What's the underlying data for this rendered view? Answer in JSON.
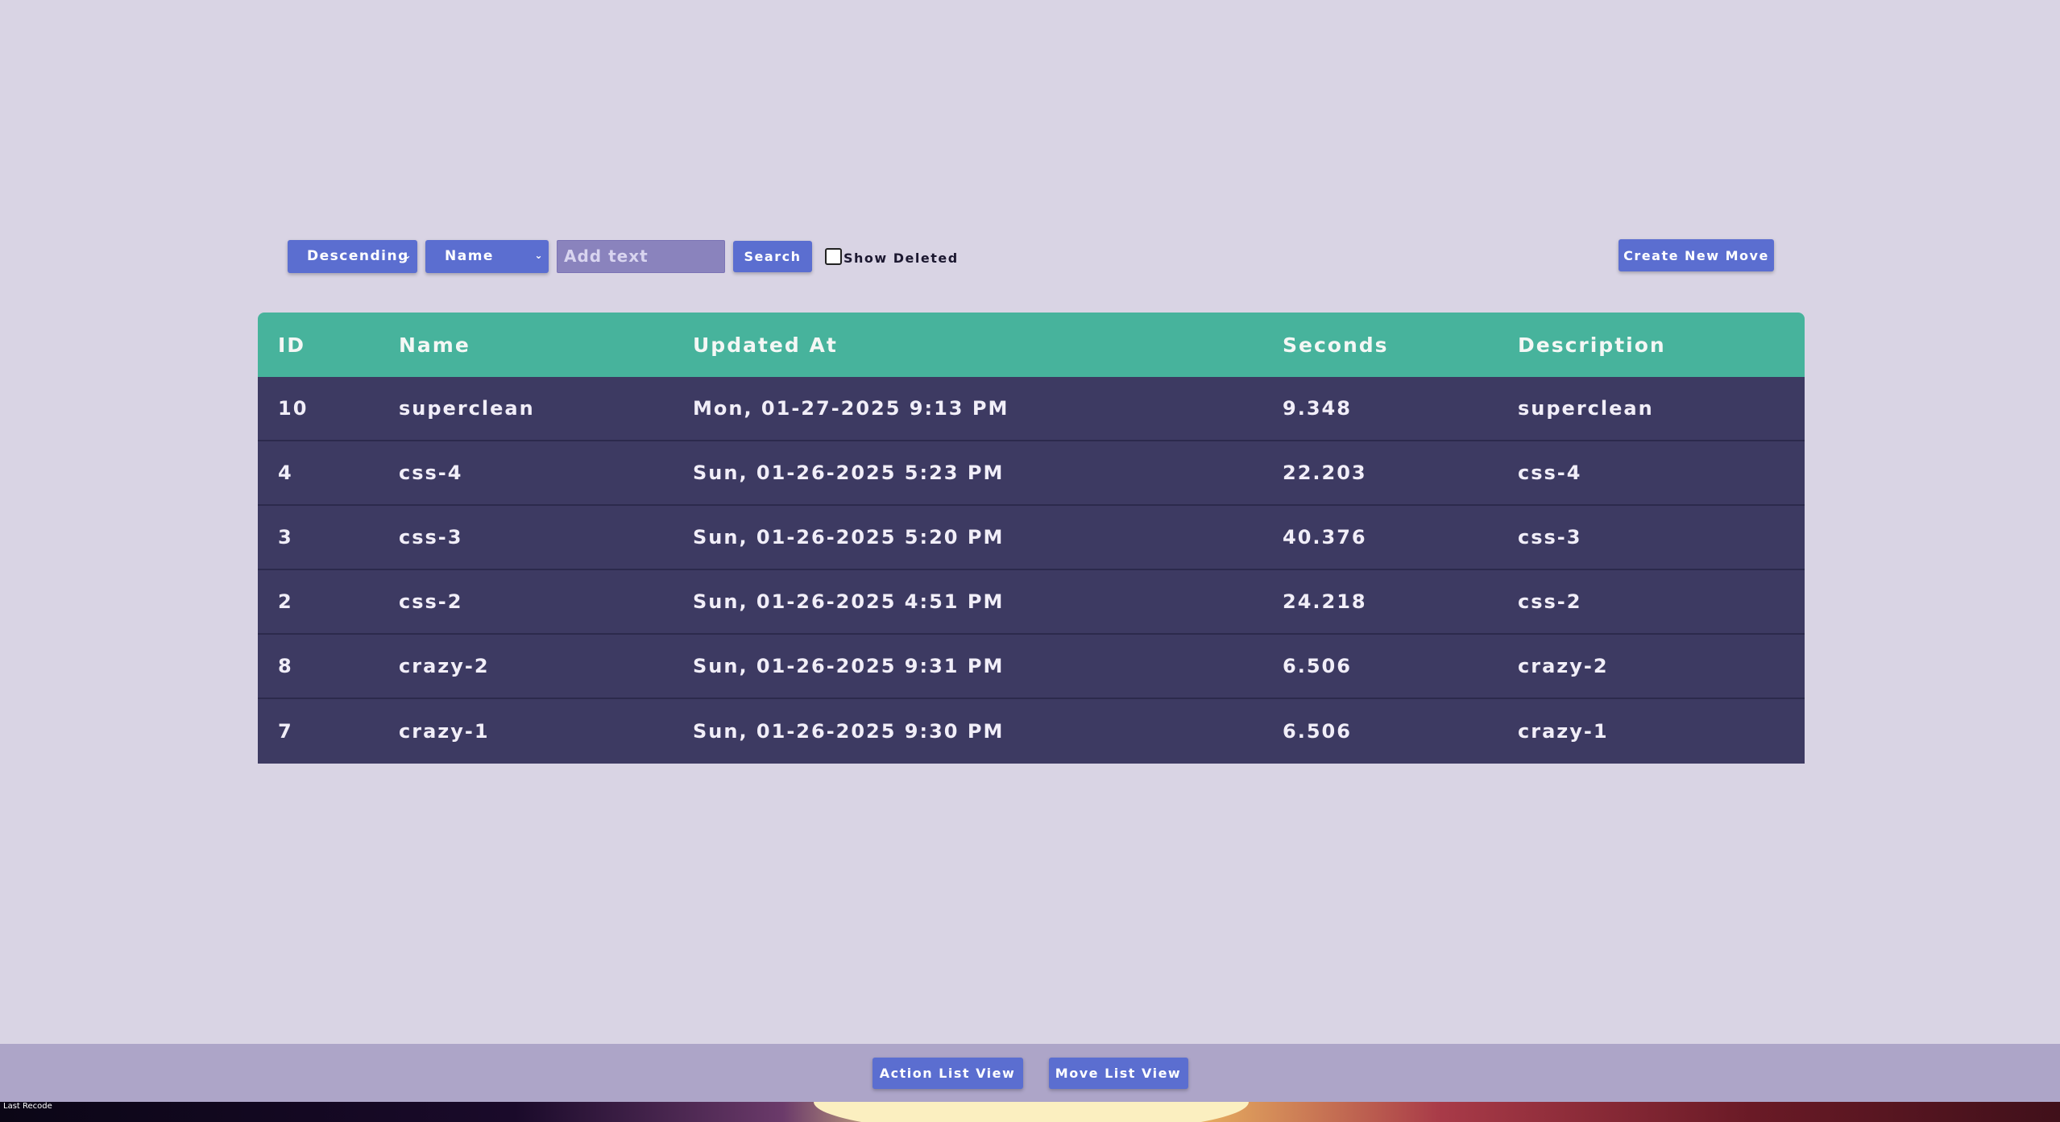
{
  "toolbar": {
    "sort_order": "Descending",
    "sort_field": "Name",
    "search_placeholder": "Add text",
    "search_value": "",
    "search_label": "Search",
    "show_deleted_label": "Show Deleted",
    "show_deleted_checked": false,
    "create_label": "Create New Move"
  },
  "table": {
    "headers": {
      "id": "ID",
      "name": "Name",
      "updated_at": "Updated At",
      "seconds": "Seconds",
      "description": "Description"
    },
    "rows": [
      {
        "id": "10",
        "name": "superclean",
        "updated_at": "Mon, 01-27-2025 9:13 PM",
        "seconds": "9.348",
        "description": "superclean"
      },
      {
        "id": "4",
        "name": "css-4",
        "updated_at": "Sun, 01-26-2025 5:23 PM",
        "seconds": "22.203",
        "description": "css-4"
      },
      {
        "id": "3",
        "name": "css-3",
        "updated_at": "Sun, 01-26-2025 5:20 PM",
        "seconds": "40.376",
        "description": "css-3"
      },
      {
        "id": "2",
        "name": "css-2",
        "updated_at": "Sun, 01-26-2025 4:51 PM",
        "seconds": "24.218",
        "description": "css-2"
      },
      {
        "id": "8",
        "name": "crazy-2",
        "updated_at": "Sun, 01-26-2025 9:31 PM",
        "seconds": "6.506",
        "description": "crazy-2"
      },
      {
        "id": "7",
        "name": "crazy-1",
        "updated_at": "Sun, 01-26-2025 9:30 PM",
        "seconds": "6.506",
        "description": "crazy-1"
      }
    ]
  },
  "footer": {
    "action_list_label": "Action List View",
    "move_list_label": "Move List View",
    "corner_text": "Last Recode"
  },
  "colors": {
    "background": "#d9d4e4",
    "button": "#5b6ed0",
    "table_header": "#47b39c",
    "table_row": "#3d3a62",
    "footer": "#ada5c8"
  },
  "icons": {
    "select_chevron": "chevron-down-icon",
    "checkbox": "checkbox-icon"
  }
}
